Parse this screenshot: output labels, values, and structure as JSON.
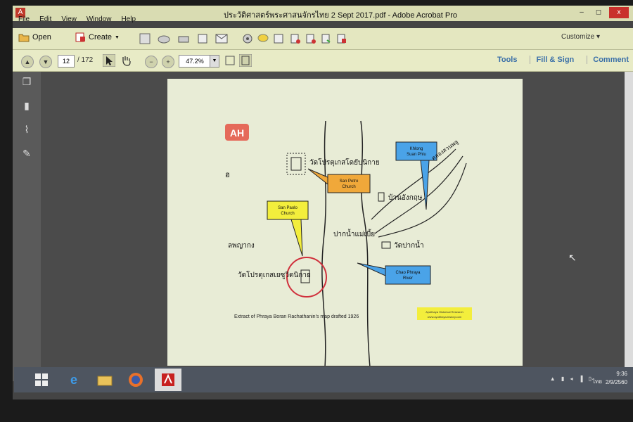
{
  "window": {
    "title": "ประวัติศาสตร์พระศาสนจักรไทย 2 Sept 2017.pdf - Adobe Acrobat Pro",
    "controls": [
      "–",
      "◻",
      "x"
    ],
    "close_doc": "x"
  },
  "menu": [
    "File",
    "Edit",
    "View",
    "Window",
    "Help"
  ],
  "toolbar": {
    "open_label": "Open",
    "create_label": "Create"
  },
  "nav": {
    "current_page": "12",
    "total_pages": "/ 172",
    "zoom": "47.2%",
    "customize": "Customize"
  },
  "tabs": [
    "Tools",
    "Fill & Sign",
    "Comment"
  ],
  "document": {
    "logo": "AH",
    "thai_glyph_left": "ฮ",
    "temple_upper": "วัดโปรตุเกสโดยับนิกาย",
    "san_petro": "San Petro\nChurch",
    "khlong": "Khlong\nSuan Phlu",
    "khlong_thai": "คลองสวนพลู",
    "ban_angkrit": "บ้านอังกฤษ",
    "san_paolo": "San Paolo\nChurch",
    "pak_nam": "ปากน้ำแม่เบี้ย",
    "wat_pak": "วัดปากน้ำ",
    "lak_pha": "ลพญากง",
    "temple_lower": "วัดโปรตุเกสเยซูวิตนิกาย",
    "chao_phraya": "Chao Phraya\nRiver",
    "caption": "Extract of Phraya Boran Rachathanin's map drafted 1926",
    "credit_line1": "Ayutthaya Historical Research",
    "credit_line2": "www.ayutthaya-history.com"
  },
  "taskbar": {
    "time": "9:36",
    "date": "2/9/2560",
    "lang": "ไทย"
  },
  "colors": {
    "callout_blue": "#4aa3e8",
    "callout_orange": "#f0a83a",
    "callout_yellow": "#f3ee3c",
    "circle_red": "#d0303c"
  }
}
